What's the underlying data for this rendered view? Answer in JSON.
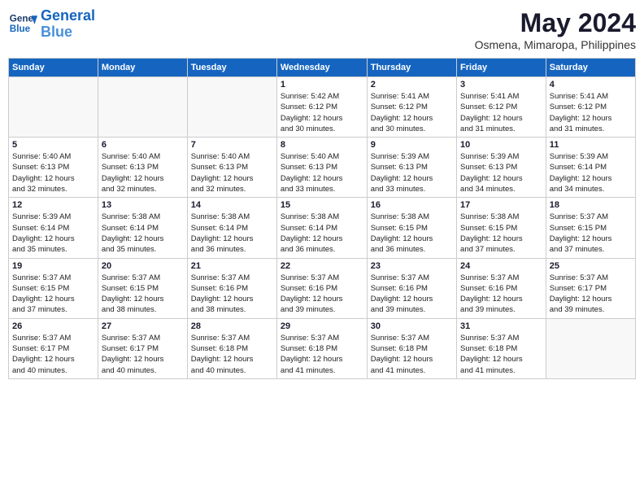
{
  "logo": {
    "line1": "General",
    "line2": "Blue"
  },
  "title": "May 2024",
  "location": "Osmena, Mimaropa, Philippines",
  "days_of_week": [
    "Sunday",
    "Monday",
    "Tuesday",
    "Wednesday",
    "Thursday",
    "Friday",
    "Saturday"
  ],
  "weeks": [
    [
      {
        "day": "",
        "info": ""
      },
      {
        "day": "",
        "info": ""
      },
      {
        "day": "",
        "info": ""
      },
      {
        "day": "1",
        "info": "Sunrise: 5:42 AM\nSunset: 6:12 PM\nDaylight: 12 hours\nand 30 minutes."
      },
      {
        "day": "2",
        "info": "Sunrise: 5:41 AM\nSunset: 6:12 PM\nDaylight: 12 hours\nand 30 minutes."
      },
      {
        "day": "3",
        "info": "Sunrise: 5:41 AM\nSunset: 6:12 PM\nDaylight: 12 hours\nand 31 minutes."
      },
      {
        "day": "4",
        "info": "Sunrise: 5:41 AM\nSunset: 6:12 PM\nDaylight: 12 hours\nand 31 minutes."
      }
    ],
    [
      {
        "day": "5",
        "info": "Sunrise: 5:40 AM\nSunset: 6:13 PM\nDaylight: 12 hours\nand 32 minutes."
      },
      {
        "day": "6",
        "info": "Sunrise: 5:40 AM\nSunset: 6:13 PM\nDaylight: 12 hours\nand 32 minutes."
      },
      {
        "day": "7",
        "info": "Sunrise: 5:40 AM\nSunset: 6:13 PM\nDaylight: 12 hours\nand 32 minutes."
      },
      {
        "day": "8",
        "info": "Sunrise: 5:40 AM\nSunset: 6:13 PM\nDaylight: 12 hours\nand 33 minutes."
      },
      {
        "day": "9",
        "info": "Sunrise: 5:39 AM\nSunset: 6:13 PM\nDaylight: 12 hours\nand 33 minutes."
      },
      {
        "day": "10",
        "info": "Sunrise: 5:39 AM\nSunset: 6:13 PM\nDaylight: 12 hours\nand 34 minutes."
      },
      {
        "day": "11",
        "info": "Sunrise: 5:39 AM\nSunset: 6:14 PM\nDaylight: 12 hours\nand 34 minutes."
      }
    ],
    [
      {
        "day": "12",
        "info": "Sunrise: 5:39 AM\nSunset: 6:14 PM\nDaylight: 12 hours\nand 35 minutes."
      },
      {
        "day": "13",
        "info": "Sunrise: 5:38 AM\nSunset: 6:14 PM\nDaylight: 12 hours\nand 35 minutes."
      },
      {
        "day": "14",
        "info": "Sunrise: 5:38 AM\nSunset: 6:14 PM\nDaylight: 12 hours\nand 36 minutes."
      },
      {
        "day": "15",
        "info": "Sunrise: 5:38 AM\nSunset: 6:14 PM\nDaylight: 12 hours\nand 36 minutes."
      },
      {
        "day": "16",
        "info": "Sunrise: 5:38 AM\nSunset: 6:15 PM\nDaylight: 12 hours\nand 36 minutes."
      },
      {
        "day": "17",
        "info": "Sunrise: 5:38 AM\nSunset: 6:15 PM\nDaylight: 12 hours\nand 37 minutes."
      },
      {
        "day": "18",
        "info": "Sunrise: 5:37 AM\nSunset: 6:15 PM\nDaylight: 12 hours\nand 37 minutes."
      }
    ],
    [
      {
        "day": "19",
        "info": "Sunrise: 5:37 AM\nSunset: 6:15 PM\nDaylight: 12 hours\nand 37 minutes."
      },
      {
        "day": "20",
        "info": "Sunrise: 5:37 AM\nSunset: 6:15 PM\nDaylight: 12 hours\nand 38 minutes."
      },
      {
        "day": "21",
        "info": "Sunrise: 5:37 AM\nSunset: 6:16 PM\nDaylight: 12 hours\nand 38 minutes."
      },
      {
        "day": "22",
        "info": "Sunrise: 5:37 AM\nSunset: 6:16 PM\nDaylight: 12 hours\nand 39 minutes."
      },
      {
        "day": "23",
        "info": "Sunrise: 5:37 AM\nSunset: 6:16 PM\nDaylight: 12 hours\nand 39 minutes."
      },
      {
        "day": "24",
        "info": "Sunrise: 5:37 AM\nSunset: 6:16 PM\nDaylight: 12 hours\nand 39 minutes."
      },
      {
        "day": "25",
        "info": "Sunrise: 5:37 AM\nSunset: 6:17 PM\nDaylight: 12 hours\nand 39 minutes."
      }
    ],
    [
      {
        "day": "26",
        "info": "Sunrise: 5:37 AM\nSunset: 6:17 PM\nDaylight: 12 hours\nand 40 minutes."
      },
      {
        "day": "27",
        "info": "Sunrise: 5:37 AM\nSunset: 6:17 PM\nDaylight: 12 hours\nand 40 minutes."
      },
      {
        "day": "28",
        "info": "Sunrise: 5:37 AM\nSunset: 6:18 PM\nDaylight: 12 hours\nand 40 minutes."
      },
      {
        "day": "29",
        "info": "Sunrise: 5:37 AM\nSunset: 6:18 PM\nDaylight: 12 hours\nand 41 minutes."
      },
      {
        "day": "30",
        "info": "Sunrise: 5:37 AM\nSunset: 6:18 PM\nDaylight: 12 hours\nand 41 minutes."
      },
      {
        "day": "31",
        "info": "Sunrise: 5:37 AM\nSunset: 6:18 PM\nDaylight: 12 hours\nand 41 minutes."
      },
      {
        "day": "",
        "info": ""
      }
    ]
  ]
}
